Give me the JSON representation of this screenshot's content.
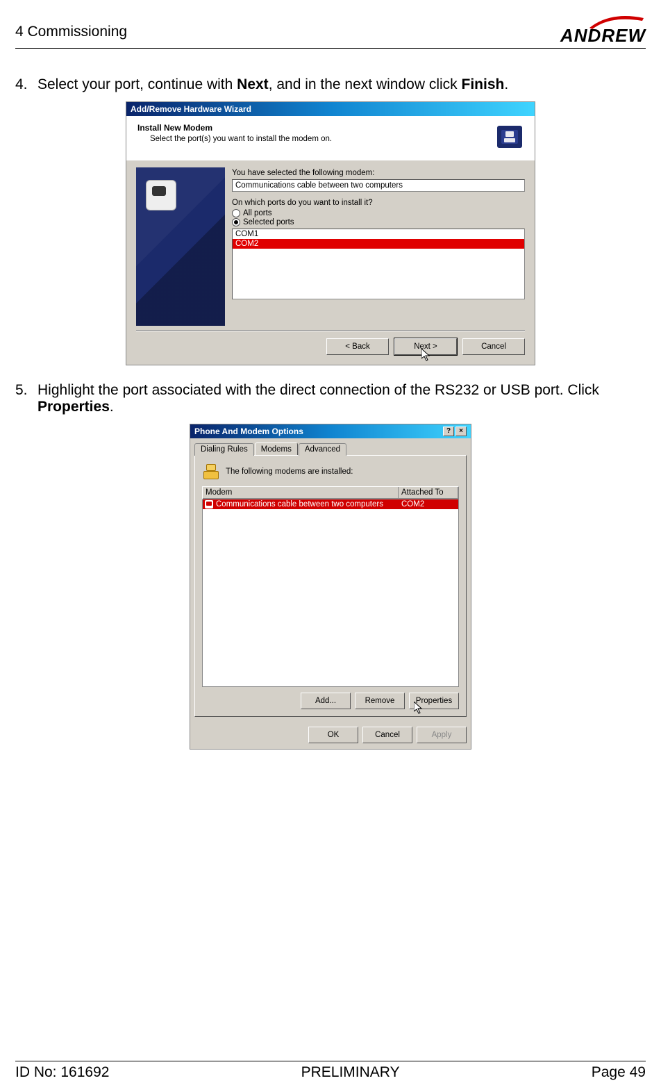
{
  "header": {
    "title": "4 Commissioning",
    "brand": "ANDREW"
  },
  "step4": {
    "num": "4.",
    "pre": "Select your port, continue with ",
    "b1": "Next",
    "mid": ", and in the next window click ",
    "b2": "Finish",
    "post": "."
  },
  "dialog1": {
    "title": "Add/Remove Hardware Wizard",
    "heading": "Install New Modem",
    "subheading": "Select the port(s) you want to install the modem on.",
    "label_selected": "You have selected the following modem:",
    "selected_value": "Communications cable between two computers",
    "label_ports": "On which ports do you want to install it?",
    "radio_all": "All ports",
    "radio_sel": "Selected ports",
    "ports": {
      "p0": "COM1",
      "p1": "COM2"
    },
    "btn_back": "< Back",
    "btn_next": "Next >",
    "btn_cancel": "Cancel"
  },
  "step5": {
    "num": "5.",
    "pre": "Highlight the port associated with the direct connection of the RS232 or USB port. Click ",
    "b1": "Properties",
    "post": "."
  },
  "dialog2": {
    "title": "Phone And Modem Options",
    "tab1": "Dialing Rules",
    "tab2": "Modems",
    "tab3": "Advanced",
    "installed_label": "The following modems are  installed:",
    "col_modem": "Modem",
    "col_attached": "Attached To",
    "row_modem": "Communications cable between two computers",
    "row_port": "COM2",
    "btn_add": "Add...",
    "btn_remove": "Remove",
    "btn_props": "Properties",
    "btn_ok": "OK",
    "btn_cancel": "Cancel",
    "btn_apply": "Apply"
  },
  "footer": {
    "id": "ID No: 161692",
    "status": "PRELIMINARY",
    "page": "Page 49"
  }
}
